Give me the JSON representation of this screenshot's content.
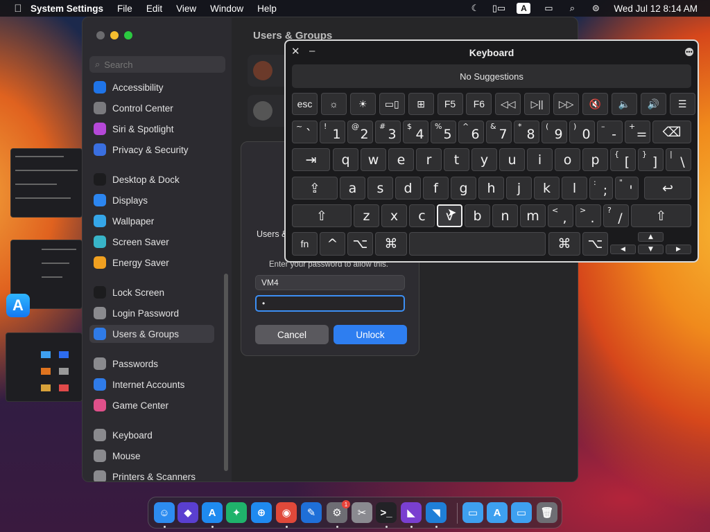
{
  "menubar": {
    "app_name": "System Settings",
    "menus": [
      "File",
      "Edit",
      "View",
      "Window",
      "Help"
    ],
    "input_source": "A",
    "datetime": "Wed Jul 12  8:14 AM"
  },
  "settings": {
    "search_placeholder": "Search",
    "content_title": "Users & Groups",
    "sidebar_items": [
      {
        "label": "Accessibility",
        "icon": "accessibility-icon",
        "color": "#1f74e8"
      },
      {
        "label": "Control Center",
        "icon": "control-center-icon",
        "color": "#7a7a7e"
      },
      {
        "label": "Siri & Spotlight",
        "icon": "siri-icon",
        "color": "#b548d8"
      },
      {
        "label": "Privacy & Security",
        "icon": "hand-icon",
        "color": "#3a6fe0"
      },
      {
        "label": "Desktop & Dock",
        "icon": "desktop-icon",
        "color": "#1c1c1e"
      },
      {
        "label": "Displays",
        "icon": "displays-icon",
        "color": "#2c86f0"
      },
      {
        "label": "Wallpaper",
        "icon": "wallpaper-icon",
        "color": "#35a6e8"
      },
      {
        "label": "Screen Saver",
        "icon": "screen-saver-icon",
        "color": "#38b4c8"
      },
      {
        "label": "Energy Saver",
        "icon": "energy-icon",
        "color": "#f0a020"
      },
      {
        "label": "Lock Screen",
        "icon": "lock-icon",
        "color": "#1c1c1e"
      },
      {
        "label": "Login Password",
        "icon": "login-password-icon",
        "color": "#8a8a8e"
      },
      {
        "label": "Users & Groups",
        "icon": "users-icon",
        "color": "#2f7be8"
      },
      {
        "label": "Passwords",
        "icon": "key-icon",
        "color": "#8a8a8e"
      },
      {
        "label": "Internet Accounts",
        "icon": "at-icon",
        "color": "#2f7be8"
      },
      {
        "label": "Game Center",
        "icon": "game-center-icon",
        "color": "#e0508a"
      },
      {
        "label": "Keyboard",
        "icon": "keyboard-icon",
        "color": "#8a8a8e"
      },
      {
        "label": "Mouse",
        "icon": "mouse-icon",
        "color": "#8a8a8e"
      },
      {
        "label": "Printers & Scanners",
        "icon": "printer-icon",
        "color": "#8a8a8e"
      }
    ]
  },
  "dialog": {
    "message": "Users &",
    "prompt": "Enter your password to allow this.",
    "username": "VM4",
    "password_value": "•",
    "cancel_label": "Cancel",
    "unlock_label": "Unlock",
    "accent": "#2e7ef0"
  },
  "keyboard_viewer": {
    "title": "Keyboard",
    "suggestions": "No Suggestions",
    "function_row": [
      "esc",
      "☼",
      "☀",
      "▭▯",
      "⊞",
      "F5",
      "F6",
      "◁◁",
      "▷||",
      "▷▷",
      "🔇",
      "🔈",
      "🔊",
      "☰"
    ],
    "row1": [
      {
        "sm": "~",
        "main": "`"
      },
      {
        "sm": "!",
        "main": "1"
      },
      {
        "sm": "@",
        "main": "2"
      },
      {
        "sm": "#",
        "main": "3"
      },
      {
        "sm": "$",
        "main": "4"
      },
      {
        "sm": "%",
        "main": "5"
      },
      {
        "sm": "^",
        "main": "6"
      },
      {
        "sm": "&",
        "main": "7"
      },
      {
        "sm": "*",
        "main": "8"
      },
      {
        "sm": "(",
        "main": "9"
      },
      {
        "sm": ")",
        "main": "0"
      },
      {
        "sm": "–",
        "main": "-"
      },
      {
        "sm": "+",
        "main": "="
      }
    ],
    "row2": [
      "q",
      "w",
      "e",
      "r",
      "t",
      "y",
      "u",
      "i",
      "o",
      "p"
    ],
    "row2_pairs": [
      {
        "sm": "{",
        "main": "["
      },
      {
        "sm": "}",
        "main": "]"
      },
      {
        "sm": "|",
        "main": "\\"
      }
    ],
    "row3": [
      "a",
      "s",
      "d",
      "f",
      "g",
      "h",
      "j",
      "k",
      "l"
    ],
    "row3_pairs": [
      {
        "sm": ":",
        "main": ";"
      },
      {
        "sm": "\"",
        "main": "'"
      }
    ],
    "row4": [
      "z",
      "x",
      "c",
      "v",
      "b",
      "n",
      "m"
    ],
    "row4_pairs": [
      {
        "sm": "<",
        "main": ","
      },
      {
        "sm": ">",
        "main": "."
      },
      {
        "sm": "?",
        "main": "/"
      }
    ],
    "mod_keys": {
      "tab": "⇥",
      "caps": "⇪",
      "return": "↩",
      "shift": "⇧",
      "delete": "⌫",
      "fn": "fn",
      "control": "^",
      "option": "⌥",
      "command": "⌘"
    },
    "arrows": {
      "up": "▲",
      "left": "◀",
      "down": "▼",
      "right": "▶"
    },
    "highlighted_key": "v"
  },
  "dock": {
    "apps": [
      {
        "name": "finder-icon",
        "glyph": "☺",
        "color": "#2d8cf0"
      },
      {
        "name": "shortcuts-icon",
        "glyph": "◆",
        "color": "#5a3fd0"
      },
      {
        "name": "app-store-icon",
        "glyph": "A",
        "color": "#1f8af0"
      },
      {
        "name": "maps-icon",
        "glyph": "✦",
        "color": "#1fb36b"
      },
      {
        "name": "safari-icon",
        "glyph": "⊕",
        "color": "#1f8af0"
      },
      {
        "name": "chrome-icon",
        "glyph": "◉",
        "color": "#e0493a"
      },
      {
        "name": "xcode-icon",
        "glyph": "✎",
        "color": "#1f6fd8"
      },
      {
        "name": "system-settings-icon",
        "glyph": "⚙",
        "color": "#6e6e74"
      },
      {
        "name": "utilities-icon",
        "glyph": "✂",
        "color": "#8a8a90"
      },
      {
        "name": "terminal-icon",
        "glyph": ">_",
        "color": "#222226"
      },
      {
        "name": "visual-studio-icon",
        "glyph": "◣",
        "color": "#7a3fd0"
      },
      {
        "name": "vscode-icon",
        "glyph": "◥",
        "color": "#1f7fd8"
      },
      {
        "name": "folder-icon",
        "glyph": "▭",
        "color": "#3ea0f0"
      },
      {
        "name": "applications-folder-icon",
        "glyph": "A",
        "color": "#3ea0f0"
      },
      {
        "name": "downloads-folder-icon",
        "glyph": "▭",
        "color": "#3ea0f0"
      },
      {
        "name": "trash-icon",
        "glyph": "🗑",
        "color": "#6e6e74"
      }
    ],
    "badge": "1"
  }
}
